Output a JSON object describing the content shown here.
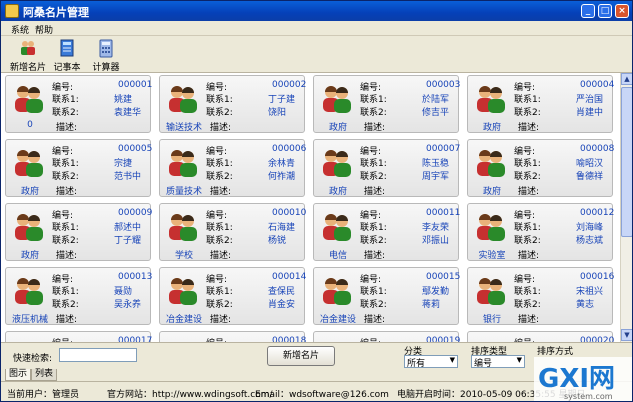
{
  "window": {
    "title": "阿桑名片管理",
    "min": "_",
    "max": "□",
    "close": "×"
  },
  "menu": [
    "系统",
    "帮助"
  ],
  "toolbar": [
    {
      "label": "新增名片",
      "icon": "people-add-icon"
    },
    {
      "label": "记事本",
      "icon": "notebook-icon"
    },
    {
      "label": "计算器",
      "icon": "calculator-icon"
    }
  ],
  "labels": {
    "id": "编号:",
    "c1": "联系1:",
    "c2": "联系2:",
    "desc": "描述:"
  },
  "cards": [
    {
      "id": "000001",
      "c1": "姚建",
      "c2": "袁建华",
      "cat": "0"
    },
    {
      "id": "000002",
      "c1": "丁子建",
      "c2": "饶阳",
      "cat": "输送技术"
    },
    {
      "id": "000003",
      "c1": "於陆军",
      "c2": "修吉平",
      "cat": "政府"
    },
    {
      "id": "000004",
      "c1": "严治国",
      "c2": "肖建中",
      "cat": "政府"
    },
    {
      "id": "000005",
      "c1": "宗捷",
      "c2": "范书中",
      "cat": "政府"
    },
    {
      "id": "000006",
      "c1": "余林青",
      "c2": "何祚潮",
      "cat": "质量技术"
    },
    {
      "id": "000007",
      "c1": "陈玉稳",
      "c2": "周宇军",
      "cat": "政府"
    },
    {
      "id": "000008",
      "c1": "喻昭汉",
      "c2": "鲁德祥",
      "cat": "政府"
    },
    {
      "id": "000009",
      "c1": "郝述中",
      "c2": "丁子耀",
      "cat": "政府"
    },
    {
      "id": "000010",
      "c1": "石海建",
      "c2": "杨锐",
      "cat": "学校"
    },
    {
      "id": "000011",
      "c1": "李友荣",
      "c2": "邓振山",
      "cat": "电信"
    },
    {
      "id": "000012",
      "c1": "刘海峰",
      "c2": "杨志斌",
      "cat": "实验室"
    },
    {
      "id": "000013",
      "c1": "聂勋",
      "c2": "吴永养",
      "cat": "液压机械"
    },
    {
      "id": "000014",
      "c1": "查保民",
      "c2": "肖金安",
      "cat": "冶金建设"
    },
    {
      "id": "000015",
      "c1": "鄢发勤",
      "c2": "蒋莉",
      "cat": "冶金建设"
    },
    {
      "id": "000016",
      "c1": "宋祖兴",
      "c2": "黄志",
      "cat": "银行"
    },
    {
      "id": "000017",
      "c1": "",
      "c2": "",
      "cat": ""
    },
    {
      "id": "000018",
      "c1": "",
      "c2": "",
      "cat": ""
    },
    {
      "id": "000019",
      "c1": "",
      "c2": "",
      "cat": ""
    },
    {
      "id": "000020",
      "c1": "",
      "c2": "",
      "cat": ""
    }
  ],
  "bottom": {
    "search_label": "快速检索:",
    "search_value": "",
    "add_button": "新增名片",
    "category_label": "分类",
    "category_value": "所有",
    "sort_type_label": "排序类型",
    "sort_type_value": "编号",
    "sort_mode_label": "排序方式"
  },
  "tabs": [
    "图示",
    "列表"
  ],
  "status": {
    "user": "当前用户：管理员",
    "website": "官方网站：http://www.wdingsoft.com/",
    "email": "Email：wdsoftware@126.com",
    "boot_time": "电脑开启时间：2010-05-09 06:35:55 星期日"
  },
  "watermark": {
    "text": "GXI网",
    "sub": "system.com"
  },
  "colors": {
    "title_blue": "#0a5fd8",
    "link_blue": "#1844b8",
    "panel": "#ece9d8"
  }
}
